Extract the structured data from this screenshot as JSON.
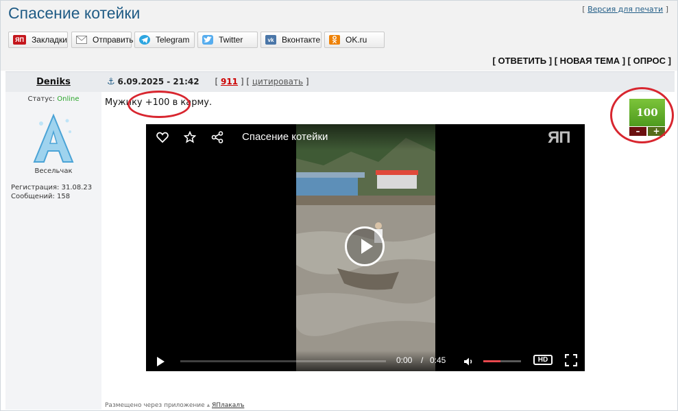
{
  "page": {
    "title": "Спасение котейки",
    "print_open": "[",
    "print_link": "Версия для печати",
    "print_close": "]"
  },
  "share_buttons": [
    {
      "label": "Закладки",
      "icon": "yap-icon",
      "color": "#c4161c"
    },
    {
      "label": "Отправить",
      "icon": "mail-icon",
      "color": "#888888"
    },
    {
      "label": "Telegram",
      "icon": "telegram-icon",
      "color": "#2ca5e0"
    },
    {
      "label": "Twitter",
      "icon": "twitter-icon",
      "color": "#55acee"
    },
    {
      "label": "Вконтакте",
      "icon": "vk-icon",
      "color": "#4a76a8"
    },
    {
      "label": "OK.ru",
      "icon": "ok-icon",
      "color": "#ee8208"
    }
  ],
  "actions": {
    "reply": "[ ОТВЕТИТЬ ]",
    "new_topic": "[ НОВАЯ ТЕМА ]",
    "poll": "[ ОПРОС ]"
  },
  "post": {
    "author": "Deniks",
    "status_label": "Статус:",
    "status_value": "Online",
    "rank": "Весельчак",
    "registration": "Регистрация: 31.08.23",
    "posts": "Сообщений: 158",
    "date": "6.09.2025 - 21:42",
    "number": "911",
    "cite": "цитировать",
    "message": "Мужику +100 в карму.",
    "karma": "100",
    "karma_minus": "–",
    "karma_plus": "+",
    "footer_text": "Размещено через приложение",
    "footer_app": "ЯПлакалъ"
  },
  "video": {
    "title": "Спасение котейки",
    "logo": "ЯП",
    "current_time": "0:00",
    "separator": "/",
    "duration": "0:45",
    "hd": "HD",
    "volume_level": 0.45,
    "progress": 0,
    "accent": "#e8484d"
  }
}
